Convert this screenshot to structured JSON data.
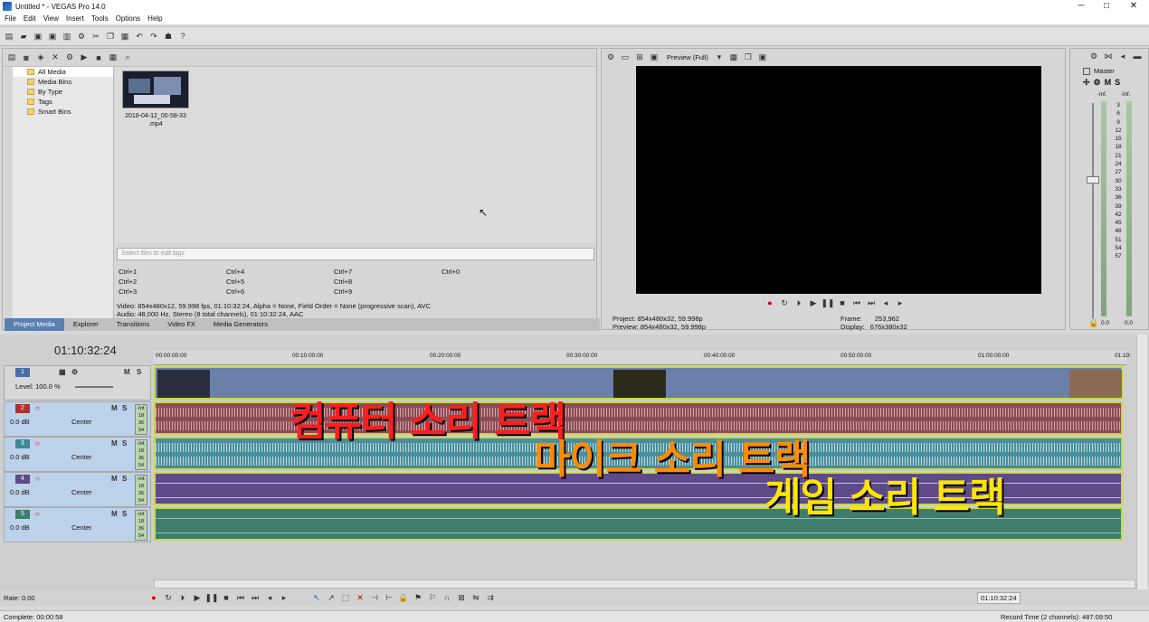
{
  "window": {
    "title": "Untitled * - VEGAS Pro 14.0",
    "min": "─",
    "max": "□",
    "close": "✕"
  },
  "menu": [
    "File",
    "Edit",
    "View",
    "Insert",
    "Tools",
    "Options",
    "Help"
  ],
  "project_media": {
    "tree": [
      "All Media",
      "Media Bins",
      "By Type",
      "Tags",
      "Smart Bins"
    ],
    "file_name": "2018-04-12_00-58-33\n.mp4",
    "tags_placeholder": "Select files to edit tags",
    "shortcuts": [
      "Ctrl+1",
      "Ctrl+2",
      "Ctrl+3",
      "Ctrl+4",
      "Ctrl+5",
      "Ctrl+6",
      "Ctrl+7",
      "Ctrl+8",
      "Ctrl+9",
      "Ctrl+0"
    ],
    "video_info": "Video: 854x480x12, 59.998 fps, 01:10:32:24, Alpha = None, Field Order = None (progressive scan), AVC",
    "audio_info": "Audio: 48,000 Hz, Stereo (8 total channels), 01:10:32:24, AAC",
    "tabs": [
      "Project Media",
      "Explorer",
      "Transitions",
      "Video FX",
      "Media Generators"
    ]
  },
  "preview": {
    "mode": "Preview (Full)",
    "project_label": "Project:",
    "project_value": "854x480x32, 59.998p",
    "preview_label": "Preview:",
    "preview_value": "854x480x32, 59.998p",
    "frame_label": "Frame:",
    "frame_value": "253,962",
    "display_label": "Display:",
    "display_value": "676x380x32"
  },
  "master": {
    "title": "Master",
    "m": "M",
    "s": "S",
    "inf_left": "-Inf.",
    "inf_right": "-Inf.",
    "scale": [
      "3",
      "6",
      "9",
      "12",
      "15",
      "18",
      "21",
      "24",
      "27",
      "30",
      "33",
      "36",
      "39",
      "42",
      "45",
      "48",
      "51",
      "54",
      "57"
    ],
    "bottom_left": "0.0",
    "bottom_right": "0.0"
  },
  "timeline": {
    "timecode": "01:10:32:24",
    "ruler": [
      "00:00:00:00",
      "00:10:00:00",
      "00:20:00:00",
      "00:30:00:00",
      "00:40:00:00",
      "00:50:00:00",
      "01:00:00:00",
      "01:10:"
    ],
    "video_track": {
      "num": "1",
      "level": "Level: 100.0 %",
      "m": "M",
      "s": "S"
    },
    "audio_tracks": [
      {
        "num": "2",
        "vol": "0.0 dB",
        "pan": "Center",
        "m": "M",
        "s": "S"
      },
      {
        "num": "3",
        "vol": "0.0 dB",
        "pan": "Center",
        "m": "M",
        "s": "S"
      },
      {
        "num": "4",
        "vol": "0.0 dB",
        "pan": "Center",
        "m": "M",
        "s": "S"
      },
      {
        "num": "5",
        "vol": "0.0 dB",
        "pan": "Center",
        "m": "M",
        "s": "S"
      }
    ],
    "mini_meter": [
      "-Inf.",
      "18",
      "36",
      "54"
    ],
    "overlay": {
      "computer": "컴퓨터 소리 트랙",
      "mic": "마이크 소리 트랙",
      "game": "게임 소리 트랙"
    }
  },
  "bottom": {
    "rate": "Rate: 0.00",
    "end_time": "01:10:32:24",
    "complete": "Complete: 00:00:58",
    "record_time": "Record Time (2 channels): 487:09:50"
  },
  "colors": {
    "accent": "#5a7fb0",
    "computer": "#ff1e1e",
    "mic": "#ff8c00",
    "game": "#ffe500"
  }
}
